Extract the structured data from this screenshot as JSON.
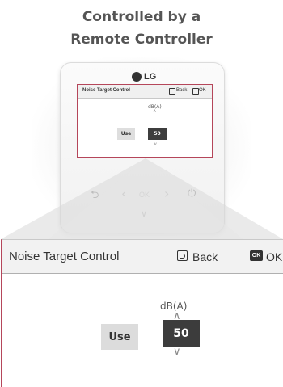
{
  "heading": {
    "line1": "Controlled by a",
    "line2": "Remote Controller"
  },
  "remote": {
    "brand": "LG",
    "buttons": {
      "back_glyph": "⮌",
      "left_glyph": "‹",
      "ok_label": "OK",
      "right_glyph": "›",
      "power_glyph": "⏻",
      "down_glyph": "∨"
    }
  },
  "screen": {
    "title": "Noise Target Control",
    "back_label": "Back",
    "ok_label": "OK",
    "ok_icon_text": "OK",
    "unit_label": "dB(A)",
    "use_label": "Use",
    "value": "50",
    "up_glyph": "∧",
    "down_glyph": "∨"
  },
  "colors": {
    "highlight_border": "#b5465a",
    "value_box": "#3c3c3c",
    "use_box": "#dcdcdc"
  }
}
